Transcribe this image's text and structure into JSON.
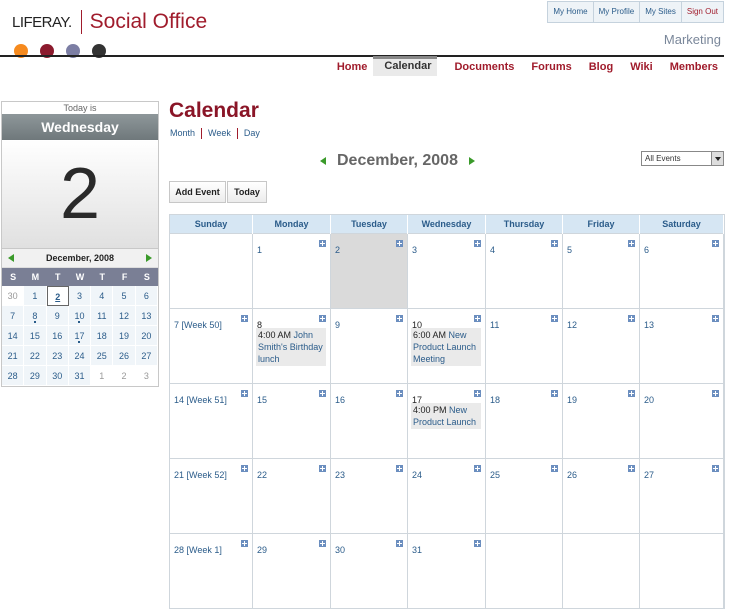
{
  "brand": {
    "liferay": "LIFERAY.",
    "social": "Social Office",
    "dots": [
      "#f68a1e",
      "#8b1a2d",
      "#7c7ea4",
      "#333333"
    ]
  },
  "topnav": [
    "My Home",
    "My Profile",
    "My Sites",
    "Sign Out"
  ],
  "site_name": "Marketing",
  "mainnav": [
    "Home",
    "Calendar",
    "Documents",
    "Forums",
    "Blog",
    "Wiki",
    "Members"
  ],
  "today": {
    "label": "Today is",
    "dow": "Wednesday",
    "day": "2"
  },
  "mini": {
    "title": "December, 2008",
    "dows": [
      "S",
      "M",
      "T",
      "W",
      "T",
      "F",
      "S"
    ],
    "days": [
      "30",
      "1",
      "2",
      "3",
      "4",
      "5",
      "6",
      "7",
      "8",
      "9",
      "10",
      "11",
      "12",
      "13",
      "14",
      "15",
      "16",
      "17",
      "18",
      "19",
      "20",
      "21",
      "22",
      "23",
      "24",
      "25",
      "26",
      "27",
      "28",
      "29",
      "30",
      "31",
      "1",
      "2",
      "3"
    ]
  },
  "calendar": {
    "title": "Calendar",
    "views": [
      "Month",
      "Week",
      "Day"
    ],
    "month_title": "December, 2008",
    "filter": "All Events",
    "add_event": "Add Event",
    "today_btn": "Today",
    "dows": [
      "Sunday",
      "Monday",
      "Tuesday",
      "Wednesday",
      "Thursday",
      "Friday",
      "Saturday"
    ],
    "week_labels": [
      "7 [Week 50]",
      "14 [Week 51]",
      "21 [Week 52]",
      "28 [Week 1]"
    ],
    "days": [
      "1",
      "2",
      "3",
      "4",
      "5",
      "6",
      "8",
      "9",
      "10",
      "11",
      "12",
      "13",
      "15",
      "16",
      "17",
      "18",
      "19",
      "20",
      "22",
      "23",
      "24",
      "25",
      "26",
      "27",
      "29",
      "30",
      "31"
    ],
    "events": {
      "e8": {
        "time": "4:00 AM",
        "title": "John Smith's Birthday lunch"
      },
      "e10": {
        "time": "6:00 AM",
        "title": "New Product Launch Meeting"
      },
      "e17": {
        "time": "4:00 PM",
        "title": "New Product Launch"
      }
    }
  }
}
